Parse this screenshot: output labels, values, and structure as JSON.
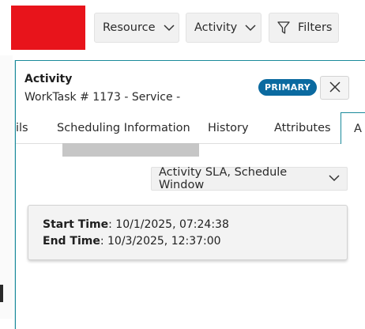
{
  "toolbar": {
    "resource_label": "Resource",
    "activity_label": "Activity",
    "filters_label": "Filters"
  },
  "panel": {
    "title": "Activity",
    "subtitle": "WorkTask # 1173 - Service -",
    "badge": "PRIMARY",
    "tabs": [
      {
        "label": "ils"
      },
      {
        "label": "Scheduling Information"
      },
      {
        "label": "History"
      },
      {
        "label": "Attributes"
      },
      {
        "label": "A"
      }
    ],
    "view_select": "Activity SLA, Schedule Window",
    "start_time_label": "Start Time",
    "start_time_value": ": 10/1/2025, 07:24:38",
    "end_time_label": "End Time",
    "end_time_value": ": 10/3/2025, 12:37:00"
  },
  "colors": {
    "brand": "#e8141b",
    "badge": "#0b6aa0",
    "panel_border": "#1a8a9a"
  },
  "icons": [
    "chevron-down-icon",
    "filter-icon",
    "close-icon"
  ]
}
